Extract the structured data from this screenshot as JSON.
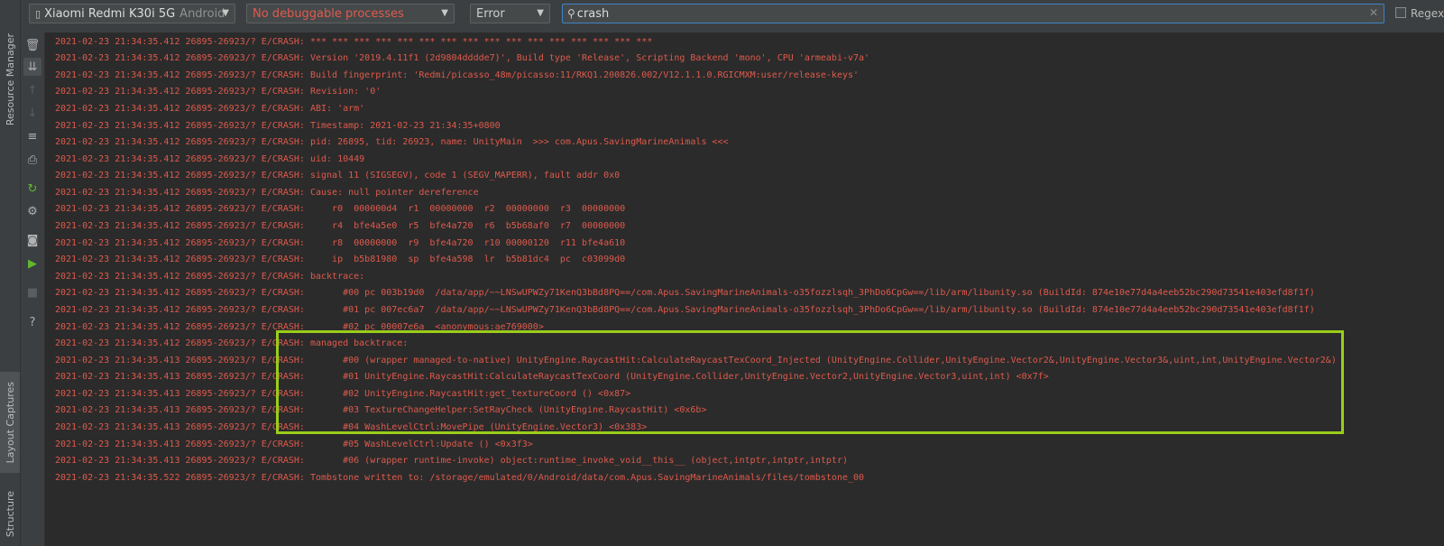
{
  "side_tabs": [
    {
      "label": "Resource Manager"
    },
    {
      "label": "Layout Captures"
    },
    {
      "label": "Structure"
    }
  ],
  "toolbar": {
    "device": {
      "name": "Xiaomi Redmi K30i 5G",
      "os": "Android"
    },
    "process": "No debuggable processes",
    "level": "Error",
    "search": {
      "value": "crash"
    },
    "regex_label": "Regex"
  },
  "actions": [
    {
      "icon": "trash-icon"
    },
    {
      "icon": "scroll-to-end-icon"
    },
    {
      "icon": "up-arrow-icon"
    },
    {
      "icon": "down-arrow-icon"
    },
    {
      "icon": "soft-wrap-icon"
    },
    {
      "icon": "print-icon"
    },
    {
      "icon": "restart-icon"
    },
    {
      "icon": "settings-gear-icon"
    },
    {
      "icon": "screenshot-camera-icon"
    },
    {
      "icon": "screen-record-icon"
    },
    {
      "icon": "stop-icon"
    },
    {
      "icon": "help-icon"
    }
  ],
  "log_lines": [
    "2021-02-23 21:34:35.412 26895-26923/? E/CRASH: *** *** *** *** *** *** *** *** *** *** *** *** *** *** *** ***",
    "2021-02-23 21:34:35.412 26895-26923/? E/CRASH: Version '2019.4.11f1 (2d9804dddde7)', Build type 'Release', Scripting Backend 'mono', CPU 'armeabi-v7a'",
    "2021-02-23 21:34:35.412 26895-26923/? E/CRASH: Build fingerprint: 'Redmi/picasso_48m/picasso:11/RKQ1.200826.002/V12.1.1.0.RGICMXM:user/release-keys'",
    "2021-02-23 21:34:35.412 26895-26923/? E/CRASH: Revision: '0'",
    "2021-02-23 21:34:35.412 26895-26923/? E/CRASH: ABI: 'arm'",
    "2021-02-23 21:34:35.412 26895-26923/? E/CRASH: Timestamp: 2021-02-23 21:34:35+0800",
    "2021-02-23 21:34:35.412 26895-26923/? E/CRASH: pid: 26895, tid: 26923, name: UnityMain  >>> com.Apus.SavingMarineAnimals <<<",
    "2021-02-23 21:34:35.412 26895-26923/? E/CRASH: uid: 10449",
    "2021-02-23 21:34:35.412 26895-26923/? E/CRASH: signal 11 (SIGSEGV), code 1 (SEGV_MAPERR), fault addr 0x0",
    "2021-02-23 21:34:35.412 26895-26923/? E/CRASH: Cause: null pointer dereference",
    "2021-02-23 21:34:35.412 26895-26923/? E/CRASH:     r0  000000d4  r1  00000000  r2  00000000  r3  00000000",
    "2021-02-23 21:34:35.412 26895-26923/? E/CRASH:     r4  bfe4a5e0  r5  bfe4a720  r6  b5b68af0  r7  00000000",
    "2021-02-23 21:34:35.412 26895-26923/? E/CRASH:     r8  00000000  r9  bfe4a720  r10 00000120  r11 bfe4a610",
    "2021-02-23 21:34:35.412 26895-26923/? E/CRASH:     ip  b5b81980  sp  bfe4a598  lr  b5b81dc4  pc  c03099d0",
    "2021-02-23 21:34:35.412 26895-26923/? E/CRASH: backtrace:",
    "2021-02-23 21:34:35.412 26895-26923/? E/CRASH:       #00 pc 003b19d0  /data/app/~~LNSwUPWZy71KenQ3bBd8PQ==/com.Apus.SavingMarineAnimals-o35fozzlsqh_3PhDo6CpGw==/lib/arm/libunity.so (BuildId: 874e10e77d4a4eeb52bc290d73541e403efd8f1f)",
    "2021-02-23 21:34:35.412 26895-26923/? E/CRASH:       #01 pc 007ec6a7  /data/app/~~LNSwUPWZy71KenQ3bBd8PQ==/com.Apus.SavingMarineAnimals-o35fozzlsqh_3PhDo6CpGw==/lib/arm/libunity.so (BuildId: 874e10e77d4a4eeb52bc290d73541e403efd8f1f)",
    "2021-02-23 21:34:35.412 26895-26923/? E/CRASH:       #02 pc 00007e6a  <anonymous:ae769000>",
    "2021-02-23 21:34:35.412 26895-26923/? E/CRASH: managed backtrace:",
    "2021-02-23 21:34:35.413 26895-26923/? E/CRASH:       #00 (wrapper managed-to-native) UnityEngine.RaycastHit:CalculateRaycastTexCoord_Injected (UnityEngine.Collider,UnityEngine.Vector2&,UnityEngine.Vector3&,uint,int,UnityEngine.Vector2&)",
    "2021-02-23 21:34:35.413 26895-26923/? E/CRASH:       #01 UnityEngine.RaycastHit:CalculateRaycastTexCoord (UnityEngine.Collider,UnityEngine.Vector2,UnityEngine.Vector3,uint,int) <0x7f>",
    "2021-02-23 21:34:35.413 26895-26923/? E/CRASH:       #02 UnityEngine.RaycastHit:get_textureCoord () <0x87>",
    "2021-02-23 21:34:35.413 26895-26923/? E/CRASH:       #03 TextureChangeHelper:SetRayCheck (UnityEngine.RaycastHit) <0x6b>",
    "2021-02-23 21:34:35.413 26895-26923/? E/CRASH:       #04 WashLevelCtrl:MovePipe (UnityEngine.Vector3) <0x383>",
    "2021-02-23 21:34:35.413 26895-26923/? E/CRASH:       #05 WashLevelCtrl:Update () <0x3f3>",
    "2021-02-23 21:34:35.413 26895-26923/? E/CRASH:       #06 (wrapper runtime-invoke) object:runtime_invoke_void__this__ (object,intptr,intptr,intptr)",
    "2021-02-23 21:34:35.522 26895-26923/? E/CRASH: Tombstone written to: /storage/emulated/0/Android/data/com.Apus.SavingMarineAnimals/files/tombstone_00"
  ]
}
